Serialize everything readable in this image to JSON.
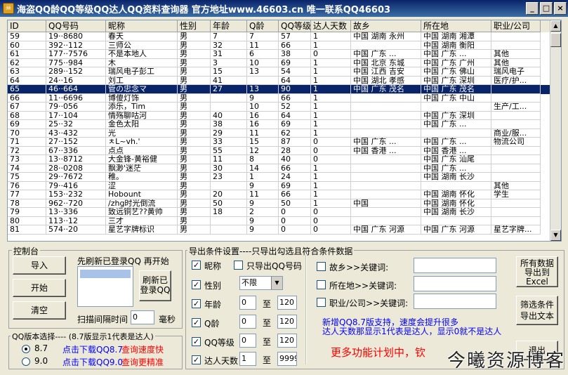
{
  "window": {
    "title": "海盗QQ龄QQ等级QQ达人QQ资料查询器 官方地址www.46603.cn 唯一联系QQ46603",
    "btn_min": "_",
    "btn_max": "□",
    "btn_close": "×"
  },
  "table": {
    "headers": [
      "ID",
      "QQ号码",
      "昵称",
      "性别",
      "年龄",
      "Q龄",
      "QQ等级",
      "达人天数",
      "故乡",
      "所在地",
      "职业/公司"
    ],
    "rows": [
      [
        "59",
        "19··8680",
        "春天",
        "男",
        "7",
        "7",
        "57",
        "1",
        "中国 湖南 永州",
        "中国 湖南 湘潭",
        ""
      ],
      [
        "60",
        "392··112",
        "三师公",
        "男",
        "32",
        "11",
        "66",
        "1",
        "",
        "中国 湖南 衡阳",
        ""
      ],
      [
        "61",
        "177··7576",
        "不是本地人",
        "男",
        "31",
        "6",
        "38",
        "0",
        "中国 广东 ...",
        "中国 广东 ...",
        "其他"
      ],
      [
        "62",
        "775··984",
        "木",
        "男",
        "3",
        "10",
        "69",
        "1",
        "中国 北京 东城",
        "中国 广东 广州",
        "其他"
      ],
      [
        "63",
        "289··152",
        "瑞风电子彭工",
        "男",
        "15",
        "13",
        "54",
        "1",
        "中国 江西 吉安",
        "中国 广东 佛山",
        "瑞风电子"
      ],
      [
        "64",
        "24··16",
        "刘工",
        "男",
        "41",
        "",
        "64",
        "1",
        "中国 湖北 孝感",
        "中国 广东 深圳",
        "医疗/护..."
      ],
      [
        "65",
        "46··664",
        "管の忠念マ",
        "男",
        "27",
        "13",
        "90",
        "1",
        "中国 广东 茂名",
        "中国 广东 茂名",
        ""
      ],
      [
        "66",
        "11··6696",
        "博傻灯饰",
        "男",
        "",
        "9",
        "66",
        "1",
        "",
        "中国 广东 中山",
        ""
      ],
      [
        "67",
        "79··056",
        "添乐，Tim",
        "男",
        "",
        "10",
        "52",
        "1",
        "",
        "",
        "生产/工..."
      ],
      [
        "68",
        "17··104",
        "情殇聊咕河",
        "男",
        "40",
        "16",
        "64",
        "1",
        "",
        "中国 广东 深圳",
        ""
      ],
      [
        "69",
        "25··32",
        "金色太阳",
        "男",
        "38",
        "16",
        "69",
        "1",
        "",
        "中国 广东 ...",
        ""
      ],
      [
        "70",
        "43··432",
        "光",
        "男",
        "29",
        "11",
        "62",
        "1",
        "",
        "",
        "商业/服..."
      ],
      [
        "71",
        "27··152",
        "ㅊL~vh.'",
        "男",
        "33",
        "15",
        "87",
        "0",
        "中国 广东 ...",
        "中国 广东 ...",
        "物流公司"
      ],
      [
        "72",
        "67··336",
        "点点",
        "男",
        "55",
        "12",
        "28",
        "0",
        "中国 香港 ...",
        "中国 香港 ...",
        ""
      ],
      [
        "73",
        "13··8712",
        "大金锋-黄裕健",
        "男",
        "11",
        "8",
        "40",
        "0",
        "",
        "中国 广东 汕尾",
        ""
      ],
      [
        "74",
        "28··0208",
        "飘渺'迷茫",
        "男",
        "30",
        "14",
        "66",
        "1",
        "",
        "中国 广东 ...",
        ""
      ],
      [
        "75",
        "29··7672",
        "稚。",
        "男",
        "23",
        "1",
        "24",
        "1",
        "",
        "中国 湖南 长沙",
        ""
      ],
      [
        "76",
        "79··416",
        "涩",
        "男",
        "",
        "9",
        "69",
        "1",
        "",
        "",
        "其他"
      ],
      [
        "77",
        "153··232",
        "Hobount",
        "男",
        "20",
        "11",
        "66",
        "1",
        "",
        "中国 湖南 怀化",
        "学生"
      ],
      [
        "78",
        "962··720",
        "/zhg时光倒流",
        "男",
        "50",
        "9",
        "50",
        "1",
        "中国",
        "中国 湖南 怀化",
        ""
      ],
      [
        "79",
        "13··336",
        "致远铜艺??黄帅",
        "男",
        "18",
        "2",
        "0",
        "0",
        "",
        "中国 湖南 长沙",
        ""
      ],
      [
        "80",
        "113··12",
        "三才",
        "男",
        "",
        "9",
        "0",
        "0",
        "",
        "",
        ""
      ],
      [
        "81",
        "574··20",
        "星艺字牌标识",
        "男",
        "",
        "9",
        "0",
        "0",
        "中国 广东 河源",
        "中国 广东 河源",
        "星艺字牌..."
      ]
    ]
  },
  "control": {
    "title": "控制台",
    "import": "导入",
    "start": "开始",
    "clear": "清空",
    "login_hint": "先刷新已登录QQ 再开始",
    "refresh": "刷新已登录QQ",
    "scan_label": "扫描间隔时间",
    "scan_value": "0",
    "scan_unit": "毫秒"
  },
  "version": {
    "title": "QQ版本选择---- (8.7版显示1代表是达人)",
    "v1": "8.7",
    "v1_link": "点击下载QQ8.7",
    "v1_note": "查询速度快",
    "v2": "9.0",
    "v2_link": "点击下载QQ9.0",
    "v2_note": "查询更精准"
  },
  "export": {
    "title": "导出条件设置----只导出勾选且符合条件数据",
    "nickname": "昵称",
    "only_qq": "只导出QQ号码",
    "gender": "性别",
    "gender_value": "不限",
    "age": "年龄",
    "age_min": "0",
    "age_max": "120",
    "qage": "Q龄",
    "qage_min": "0",
    "qage_max": "120",
    "level": "QQ等级",
    "level_min": "0",
    "level_max": "120",
    "days": "达人天数",
    "days_min": "1",
    "days_max": "9999",
    "to": "至",
    "hometown": "故乡>>关键词:",
    "location": "所在地>>关键词:",
    "job": "职业/公司>>关键词:",
    "export_all": "所有数据导出到Excel",
    "filter_export": "筛选条件导出文本",
    "notice1": "新增QQ8.7版支持，速度会提升很多",
    "notice2": "达人天数那显示1代表是达人，显示0就不是达人",
    "more": "更多功能计划中，钦",
    "exit": "退出"
  },
  "watermark": "今曦资源博客"
}
